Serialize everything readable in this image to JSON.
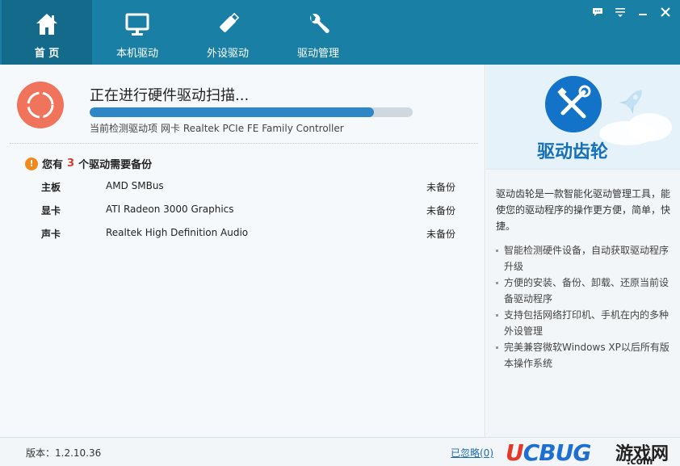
{
  "nav": {
    "tabs": [
      {
        "label": "首 页",
        "icon": "home-icon",
        "active": true
      },
      {
        "label": "本机驱动",
        "icon": "monitor-icon",
        "active": false
      },
      {
        "label": "外设驱动",
        "icon": "usb-drive-icon",
        "active": false
      },
      {
        "label": "驱动管理",
        "icon": "wrench-icon",
        "active": false
      }
    ]
  },
  "window_controls": [
    "feedback-icon",
    "menu-icon",
    "minimize-icon",
    "close-icon"
  ],
  "scan": {
    "title": "正在进行硬件驱动扫描...",
    "progress_fraction": 0.88,
    "detail_prefix": "当前检测驱动项",
    "detail_value": "网卡 Realtek PCIe FE Family Controller"
  },
  "backup_notice": {
    "before": "您有",
    "count": "3",
    "after": "个驱动需要备份"
  },
  "drivers": [
    {
      "type": "主板",
      "name": "AMD SMBus",
      "status": "未备份"
    },
    {
      "type": "显卡",
      "name": "ATI Radeon 3000 Graphics",
      "status": "未备份"
    },
    {
      "type": "声卡",
      "name": "Realtek High Definition Audio",
      "status": "未备份"
    }
  ],
  "panel": {
    "brand": "驱动齿轮",
    "description": "驱动齿轮是一款智能化驱动管理工具，能使您的驱动程序的操作更方便，简单，快捷。",
    "features": [
      "智能检测硬件设备，自动获取驱动程序升级",
      "方便的安装、备份、卸载、还原当前设备驱动程序",
      "支持包括网络打印机、手机在内的多种外设管理",
      "完美兼容微软Windows XP以后所有版本操作系统"
    ]
  },
  "footer": {
    "version": "版本：1.2.10.36",
    "ignored_link": "已忽略(0)"
  },
  "watermark": {
    "logo_u": "U",
    "logo_rest": "CBUG",
    "site": "游戏网",
    "domain": ".com"
  },
  "colors": {
    "header": "#1a7fa4",
    "header_active": "#146a8a",
    "progress": "#2d86c6",
    "scan_circle": "#f0735c",
    "warning": "#f08a1c",
    "count": "#d43a2a",
    "brand": "#1570b8"
  }
}
